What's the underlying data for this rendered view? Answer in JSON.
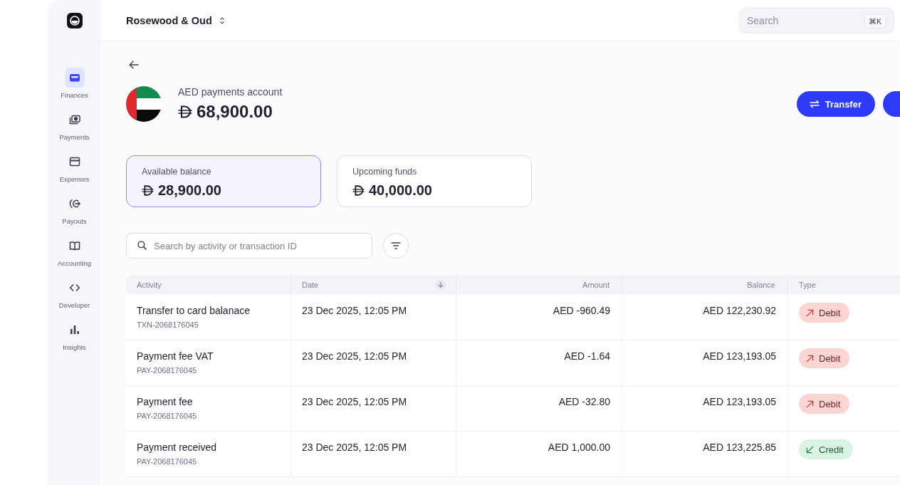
{
  "sidebar": {
    "items": [
      {
        "label": "Finances",
        "selected": true
      },
      {
        "label": "Payments",
        "selected": false
      },
      {
        "label": "Expenses",
        "selected": false
      },
      {
        "label": "Payouts",
        "selected": false
      },
      {
        "label": "Accounting",
        "selected": false
      },
      {
        "label": "Developer",
        "selected": false
      },
      {
        "label": "Insights",
        "selected": false
      }
    ]
  },
  "header": {
    "workspace": "Rosewood & Oud",
    "search": {
      "placeholder": "Search",
      "shortcut": "⌘K"
    }
  },
  "account": {
    "name": "AED payments account",
    "balance": "68,900.00",
    "actions": [
      {
        "label": "Transfer",
        "kind": "transfer"
      }
    ]
  },
  "balances": [
    {
      "label": "Available balance",
      "amount": "28,900.00",
      "selected": true
    },
    {
      "label": "Upcoming funds",
      "amount": "40,000.00",
      "selected": false
    }
  ],
  "activity_search": {
    "placeholder": "Search by activity or transaction ID"
  },
  "table": {
    "columns": [
      {
        "label": "Activity",
        "kind": "text",
        "sorted": false
      },
      {
        "label": "Date",
        "kind": "text",
        "sorted": true
      },
      {
        "label": "Amount",
        "kind": "number",
        "sorted": false
      },
      {
        "label": "Balance",
        "kind": "number",
        "sorted": false
      },
      {
        "label": "Type",
        "kind": "text",
        "sorted": false
      }
    ],
    "rows": [
      {
        "activity": "Transfer to card balanace",
        "reference": "TXN-2068176045",
        "date": "23 Dec 2025, 12:05 PM",
        "amount": "AED -960.49",
        "balance": "AED 122,230.92",
        "type": {
          "label": "Debit",
          "kind": "debit"
        }
      },
      {
        "activity": "Payment fee VAT",
        "reference": "PAY-2068176045",
        "date": "23 Dec 2025, 12:05 PM",
        "amount": "AED -1.64",
        "balance": "AED 123,193.05",
        "type": {
          "label": "Debit",
          "kind": "debit"
        }
      },
      {
        "activity": "Payment fee",
        "reference": "PAY-2068176045",
        "date": "23 Dec 2025, 12:05 PM",
        "amount": "AED -32.80",
        "balance": "AED 123,193.05",
        "type": {
          "label": "Debit",
          "kind": "debit"
        }
      },
      {
        "activity": "Payment received",
        "reference": "PAY-2068176045",
        "date": "23 Dec 2025, 12:05 PM",
        "amount": "AED 1,000.00",
        "balance": "AED 123,225.85",
        "type": {
          "label": "Credit",
          "kind": "credit"
        }
      }
    ]
  }
}
